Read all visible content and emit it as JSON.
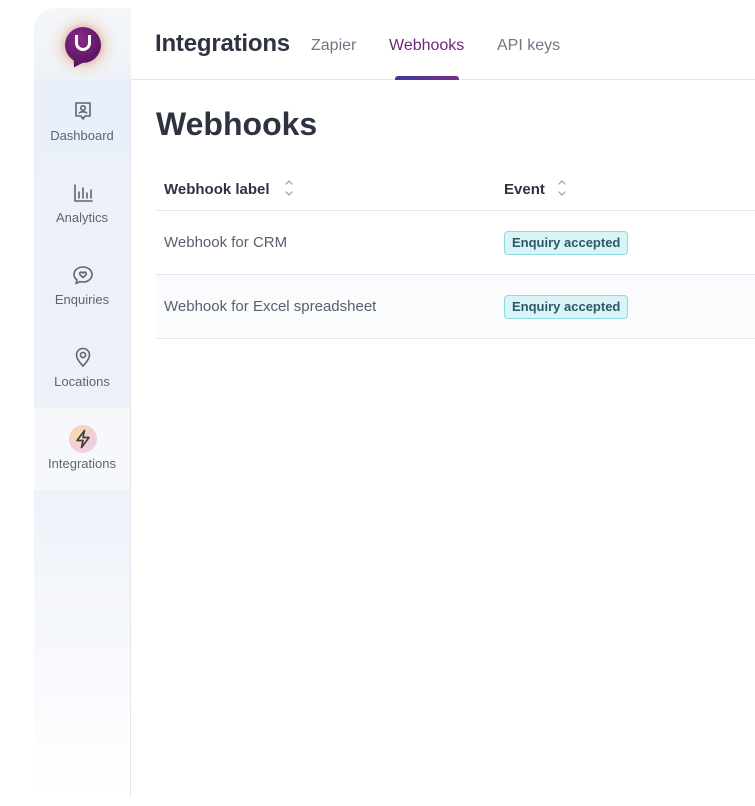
{
  "header": {
    "title": "Integrations",
    "tabs": [
      {
        "label": "Zapier",
        "active": false
      },
      {
        "label": "Webhooks",
        "active": true
      },
      {
        "label": "API keys",
        "active": false
      }
    ],
    "logo_letter": "U",
    "brand_color": "#5c1763",
    "active_tab_color": "#6a2a75"
  },
  "sidebar": {
    "items": [
      {
        "label": "Dashboard",
        "icon": "dashboard-icon",
        "active": false
      },
      {
        "label": "Analytics",
        "icon": "analytics-icon",
        "active": false
      },
      {
        "label": "Enquiries",
        "icon": "enquiries-icon",
        "active": false
      },
      {
        "label": "Locations",
        "icon": "location-pin-icon",
        "active": false
      },
      {
        "label": "Integrations",
        "icon": "lightning-icon",
        "active": true
      }
    ]
  },
  "main": {
    "heading": "Webhooks",
    "table": {
      "columns": [
        "Webhook label",
        "Event"
      ],
      "rows": [
        {
          "label": "Webhook for CRM",
          "event": "Enquiry accepted"
        },
        {
          "label": "Webhook for Excel spreadsheet",
          "event": "Enquiry accepted"
        }
      ],
      "badge_color": "#d9f4f6"
    }
  }
}
